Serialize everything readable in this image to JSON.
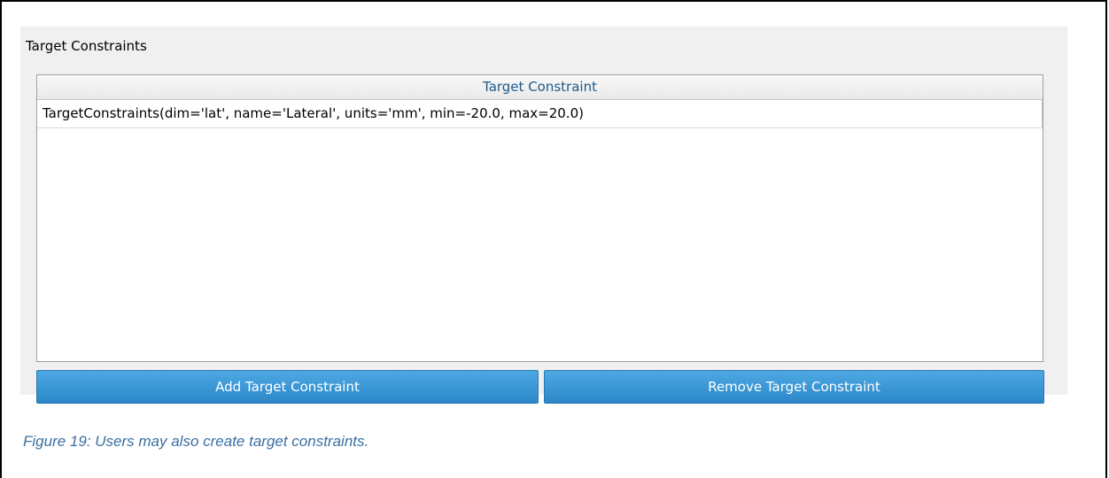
{
  "group": {
    "title": "Target Constraints"
  },
  "table": {
    "column_header": "Target Constraint",
    "rows": [
      "TargetConstraints(dim='lat', name='Lateral', units='mm', min=-20.0, max=20.0)"
    ]
  },
  "buttons": {
    "add_label": "Add Target Constraint",
    "remove_label": "Remove Target Constraint"
  },
  "caption": "Figure 19: Users may also create target constraints.",
  "colors": {
    "button": "#2b87c7",
    "header_text": "#1e5a8a",
    "caption_text": "#3a6fa3"
  }
}
